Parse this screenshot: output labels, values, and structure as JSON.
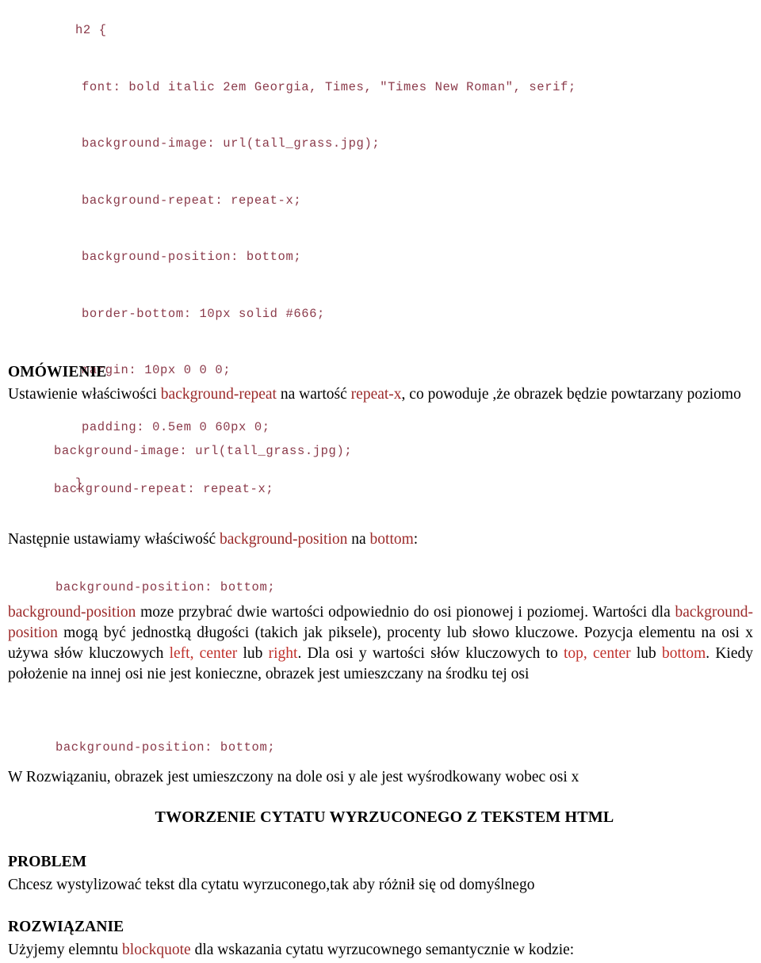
{
  "document": {
    "language": "pl",
    "colors": {
      "code_text": "#8b3a4a",
      "keyword_red": "#9c2a2a",
      "keyword_bright_red": "#c0302b",
      "body_text": "#000000",
      "background": "#ffffff"
    }
  },
  "code_listing": {
    "lines": [
      "h2 {",
      "font: bold italic 2em Georgia, Times, \"Times New Roman\", serif;",
      "background-image: url(tall_grass.jpg);",
      "background-repeat: repeat-x;",
      "background-position: bottom;",
      "border-bottom: 10px solid #666;",
      "margin: 10px 0 0 0;",
      "padding: 0.5em 0 60px 0;",
      "}"
    ]
  },
  "snippets": {
    "background_image": "background-image: url(tall_grass.jpg);",
    "background_repeat": "background-repeat: repeat-x;",
    "background_position_1": "background-position: bottom;",
    "background_position_2": "background-position: bottom;"
  },
  "sections": {
    "omowienie": {
      "heading": "OMÓWIENIE",
      "paragraph": {
        "part1": "Ustawienie właściwości ",
        "kw1": "background-repeat",
        "part2": " na wartość ",
        "kw2": "repeat-x",
        "part3": ", co powoduje ,że obrazek będzie powtarzany poziomo"
      }
    },
    "nastepnie": {
      "part1": "Następnie ustawiamy właściwość ",
      "kw1": "background-position",
      "part2": " na ",
      "kw2": "bottom",
      "part3": ":"
    },
    "opis": {
      "kw1": "background-position",
      "part1": " moze przybrać dwie wartości odpowiednio do osi pionowej i poziomej. Wartości dla ",
      "kw2": "background-position",
      "part2": "  mogą być jednostką długości (takich jak piksele), procenty lub słowo kluczowe. Pozycja elementu na osi x używa słów kluczowych ",
      "kw3": "left, center",
      "part3": " lub ",
      "kw4": "right",
      "part4": ". Dla osi y wartości słów kluczowych to ",
      "kw5": "top, center",
      "part5": " lub ",
      "kw6": "bottom",
      "part6": ". Kiedy położenie na innej osi nie jest konieczne, obrazek jest umieszczany na środku tej osi"
    },
    "rozwiazanie_note": "W Rozwiązaniu, obrazek jest umieszczony na dole osi y ale jest wyśrodkowany wobec osi x",
    "cytat_heading": "TWORZENIE CYTATU WYRZUCONEGO Z TEKSTEM HTML",
    "problem": {
      "heading": "PROBLEM",
      "paragraph": "Chcesz wystylizować tekst dla cytatu wyrzuconego,tak aby różnił się od domyślnego"
    },
    "rozwiazanie": {
      "heading": "ROZWIĄZANIE",
      "part1": "Użyjemy elemntu ",
      "kw1": "blockquote",
      "part2": " dla wskazania cytatu wyrzucownego semantycznie w kodzie:"
    }
  }
}
